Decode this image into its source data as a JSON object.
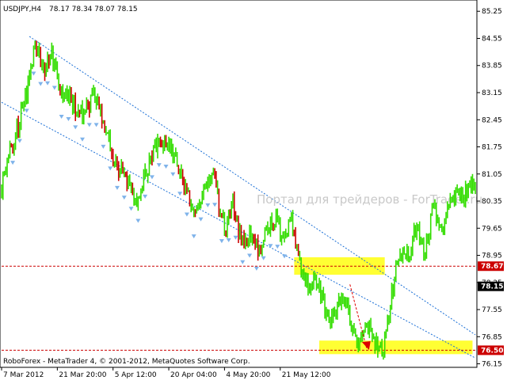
{
  "header": {
    "symbol": "USDJPY,H4",
    "ohlc": "78.17 78.34 78.07 78.15"
  },
  "watermark": "Портал для трейдеров - ForTrader.ru",
  "footer": "RoboForex - MetaTrader 4, © 2001-2012, MetaQuotes Software Corp.",
  "colors": {
    "price_line": "#33dd00",
    "candle_bear": "#cc0000",
    "channel": "#1a6fd6",
    "zone_fill": "#ffff33",
    "level_line": "#cc0000",
    "forecast_arrow": "#dd0000",
    "fractal": "#7fb3ea",
    "current_tag": "#000000"
  },
  "chart_data": {
    "type": "line",
    "symbol": "USDJPY",
    "timeframe": "H4",
    "y_ticks": [
      "85.25",
      "84.55",
      "83.85",
      "83.15",
      "82.45",
      "81.75",
      "81.05",
      "80.35",
      "79.65",
      "78.95",
      "78.25",
      "77.55",
      "76.85",
      "76.15"
    ],
    "ylim": [
      76.1,
      85.5
    ],
    "x_ticks": [
      "7 Mar 2012",
      "21 Mar 20:00",
      "5 Apr 12:00",
      "20 Apr 04:00",
      "4 May 20:00",
      "21 May 12:00"
    ],
    "x_tick_index": [
      0,
      40,
      80,
      120,
      160,
      200
    ],
    "x_count": 340,
    "level_labels": {
      "upper": "78.67",
      "current": "78.15",
      "lower": "76.50"
    },
    "levels": {
      "upper": 78.67,
      "current": 78.15,
      "lower": 76.5
    },
    "zones": [
      {
        "x_from": 210,
        "x_to": 275,
        "y_from": 78.45,
        "y_to": 78.9
      },
      {
        "x_from": 228,
        "x_to": 338,
        "y_from": 76.4,
        "y_to": 76.75
      }
    ],
    "channel": [
      {
        "x1": 0,
        "y1": 82.9,
        "x2": 340,
        "y2": 76.3
      },
      {
        "x1": 20,
        "y1": 84.6,
        "x2": 340,
        "y2": 76.9
      }
    ],
    "price_path": [
      [
        0,
        80.7
      ],
      [
        5,
        81.6
      ],
      [
        10,
        82.1
      ],
      [
        15,
        82.7
      ],
      [
        20,
        83.6
      ],
      [
        24,
        84.4
      ],
      [
        30,
        83.7
      ],
      [
        36,
        84.2
      ],
      [
        42,
        83.1
      ],
      [
        50,
        83.0
      ],
      [
        58,
        82.5
      ],
      [
        66,
        83.1
      ],
      [
        74,
        82.2
      ],
      [
        82,
        81.3
      ],
      [
        90,
        80.9
      ],
      [
        98,
        80.4
      ],
      [
        106,
        81.4
      ],
      [
        114,
        81.9
      ],
      [
        122,
        81.7
      ],
      [
        130,
        80.9
      ],
      [
        138,
        80.0
      ],
      [
        146,
        80.7
      ],
      [
        152,
        81.0
      ],
      [
        160,
        79.5
      ],
      [
        166,
        80.3
      ],
      [
        172,
        79.3
      ],
      [
        178,
        79.5
      ],
      [
        184,
        79.1
      ],
      [
        190,
        79.6
      ],
      [
        196,
        79.9
      ],
      [
        202,
        79.4
      ],
      [
        208,
        79.9
      ],
      [
        214,
        78.7
      ],
      [
        220,
        78.1
      ],
      [
        226,
        78.3
      ],
      [
        232,
        77.6
      ],
      [
        238,
        77.3
      ],
      [
        244,
        77.9
      ],
      [
        250,
        77.3
      ],
      [
        256,
        76.6
      ],
      [
        262,
        77.2
      ],
      [
        268,
        76.7
      ],
      [
        274,
        76.5
      ],
      [
        280,
        78.0
      ],
      [
        286,
        79.1
      ],
      [
        292,
        78.9
      ],
      [
        298,
        79.7
      ],
      [
        304,
        79.1
      ],
      [
        310,
        80.2
      ],
      [
        316,
        79.6
      ],
      [
        322,
        80.6
      ],
      [
        328,
        80.4
      ],
      [
        334,
        80.6
      ],
      [
        340,
        80.9
      ]
    ],
    "forecast_arrow": {
      "x1": 250,
      "y1": 78.2,
      "x2": 262,
      "y2": 76.55
    }
  }
}
